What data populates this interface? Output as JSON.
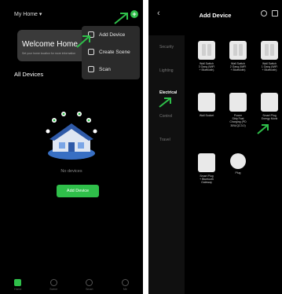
{
  "left": {
    "home_title": "My Home ▾",
    "plus_icon": "+",
    "welcome_title": "Welcome Home",
    "welcome_sub": "Set your home location for more information",
    "all_devices": "All Devices",
    "menu": [
      {
        "label": "Add Device",
        "icon": "add-device-icon"
      },
      {
        "label": "Create Scene",
        "icon": "create-scene-icon"
      },
      {
        "label": "Scan",
        "icon": "scan-icon"
      }
    ],
    "no_devices": "No devices",
    "add_device_button": "Add Device",
    "tabs": [
      {
        "label": "Home",
        "icon": "home-icon"
      },
      {
        "label": "Scene",
        "icon": "scene-icon"
      },
      {
        "label": "Smart",
        "icon": "smart-icon"
      },
      {
        "label": "Me",
        "icon": "me-icon"
      }
    ],
    "accent": "#2fbf4a"
  },
  "right": {
    "back_icon": "‹",
    "title": "Add Device",
    "categories": [
      "Security",
      "Lighting",
      "Electrical",
      "Control",
      "Travel"
    ],
    "active_category": "Electrical",
    "devices": [
      {
        "label": "Wall Switch\n3 Gang (WiFi\n+ Bluetooth)"
      },
      {
        "label": "Wall Switch\n2 Gang (WiFi\n+ Bluetooth)"
      },
      {
        "label": "Wall Switch\n1 Gang (WiFi\n+ Bluetooth)"
      },
      {
        "label": "Wall Socket"
      },
      {
        "label": "Power\nStrip Fast\nCharging (PD\n30W,QC3.0)"
      },
      {
        "label": "Smart Plug\nEnergy Monit"
      },
      {
        "label": "Smart Plug\n+ Bluetooth\nGateway"
      },
      {
        "label": "Plug"
      }
    ]
  }
}
